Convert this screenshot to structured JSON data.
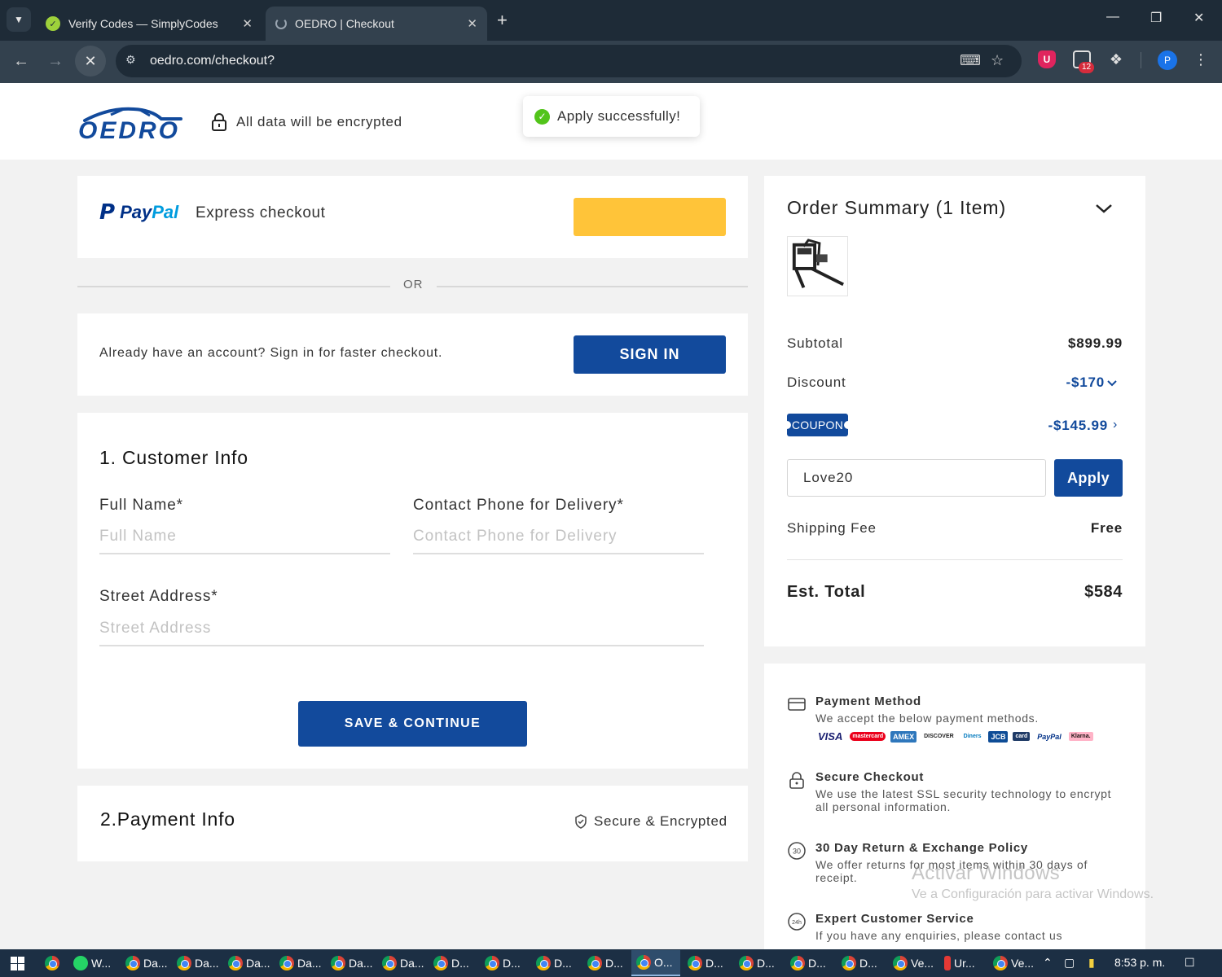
{
  "browser": {
    "tabs": [
      {
        "title": "Verify Codes — SimplyCodes",
        "favicon": "simplycodes-icon"
      },
      {
        "title": "OEDRO | Checkout",
        "favicon": "loading-spinner-icon"
      }
    ],
    "url": "oedro.com/checkout?",
    "extension_badge": "12",
    "profile_initial": "P"
  },
  "header": {
    "encrypt_text": "All data will be encrypted"
  },
  "toast": {
    "message": "Apply successfully!"
  },
  "paypal": {
    "word_pay": "Pay",
    "word_pal": "Pal",
    "express_label": "Express checkout",
    "or_text": "OR"
  },
  "signin": {
    "prompt": "Already have an account? Sign in for faster checkout.",
    "button": "SIGN IN"
  },
  "customer": {
    "title": "1. Customer Info",
    "full_name_label": "Full Name*",
    "full_name_placeholder": "Full Name",
    "phone_label": "Contact Phone for Delivery*",
    "phone_placeholder": "Contact Phone for Delivery",
    "street_label": "Street Address*",
    "street_placeholder": "Street Address",
    "save_button": "SAVE & CONTINUE"
  },
  "payment": {
    "title": "2.Payment Info",
    "secure_label": "Secure & Encrypted"
  },
  "summary": {
    "title": "Order Summary (1 Item)",
    "subtotal_label": "Subtotal",
    "subtotal_value": "$899.99",
    "discount_label": "Discount",
    "discount_value": "-$170",
    "coupon_badge": "COUPON",
    "coupon_value": "-$145.99",
    "coupon_code": "Love20",
    "apply_button": "Apply",
    "shipping_label": "Shipping Fee",
    "shipping_value": "Free",
    "total_label": "Est. Total",
    "total_value": "$584"
  },
  "info": {
    "payment_method_title": "Payment Method",
    "payment_method_desc": "We accept the below payment methods.",
    "card_logos": [
      "VISA",
      "mastercard",
      "AMEX",
      "DISCOVER",
      "Diners",
      "JCB",
      "card",
      "PayPal",
      "Klarna."
    ],
    "secure_title": "Secure Checkout",
    "secure_desc": "We use the latest SSL security technology to encrypt all personal information.",
    "return_title": "30 Day Return & Exchange Policy",
    "return_desc": "We offer returns for most items within 30 days of receipt.",
    "return_icon_text": "30",
    "service_title": "Expert Customer Service",
    "service_desc": "If you have any enquiries, please contact us",
    "service_icon_text": "24h"
  },
  "watermark": {
    "line1": "Activar Windows",
    "line2": "Ve a Configuración para activar Windows."
  },
  "taskbar": {
    "items": [
      "W...",
      "Da...",
      "Da...",
      "Da...",
      "Da...",
      "Da...",
      "Da...",
      "D...",
      "D...",
      "D...",
      "D...",
      "O...",
      "D...",
      "D...",
      "D...",
      "D...",
      "Ve...",
      "Ur...",
      "Ve..."
    ],
    "clock": "8:53 p. m."
  },
  "colors": {
    "brand_blue": "#124a9c",
    "paypal_yellow": "#ffc439",
    "success_green": "#52c41a"
  }
}
